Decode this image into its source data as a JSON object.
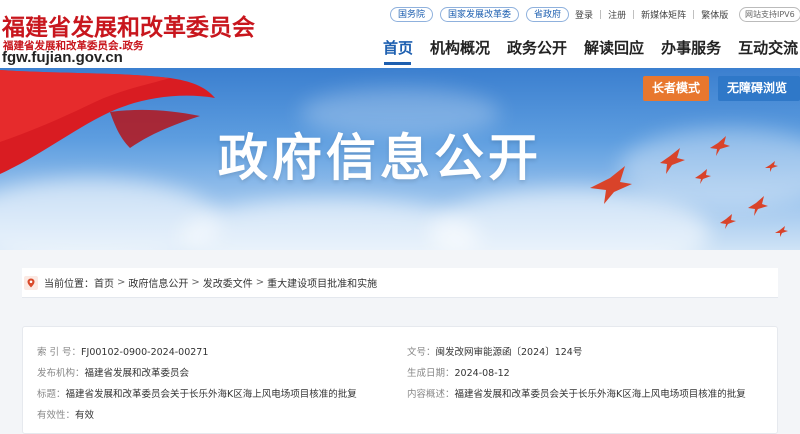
{
  "header": {
    "logo_main": "福建省发展和改革委员会",
    "logo_sub": "福建省发展和改革委员会.政务",
    "logo_url": "fgw.fujian.gov.cn",
    "top_links": [
      "国务院",
      "国家发展改革委",
      "省政府"
    ],
    "util_links": [
      "登录",
      "注册",
      "新媒体矩阵",
      "繁体版"
    ],
    "ipv6_badge": "网站支持IPV6",
    "nav": [
      "首页",
      "机构概况",
      "政务公开",
      "解读回应",
      "办事服务",
      "互动交流"
    ]
  },
  "banner": {
    "title": "政府信息公开",
    "elder_mode": "长者模式",
    "accessible_mode": "无障碍浏览"
  },
  "breadcrumb": {
    "prefix": "当前位置：",
    "items": [
      "首页",
      "政府信息公开",
      "发改委文件",
      "重大建设项目批准和实施"
    ]
  },
  "info": {
    "index_label": "索 引 号：",
    "index_value": "FJ00102-0900-2024-00271",
    "doc_no_label": "文号：",
    "doc_no_value": "闽发改网审能源函〔2024〕124号",
    "publisher_label": "发布机构：",
    "publisher_value": "福建省发展和改革委员会",
    "date_label": "生成日期：",
    "date_value": "2024-08-12",
    "title_label": "标题：",
    "title_value": "福建省发展和改革委员会关于长乐外海K区海上风电场项目核准的批复",
    "summary_label": "内容概述：",
    "summary_value": "福建省发展和改革委员会关于长乐外海K区海上风电场项目核准的批复",
    "validity_label": "有效性：",
    "validity_value": "有效"
  },
  "colors": {
    "brand_red": "#c8161d",
    "nav_blue": "#1d5fb0",
    "elder_orange": "#e8772e",
    "access_blue": "#2f78c8"
  }
}
